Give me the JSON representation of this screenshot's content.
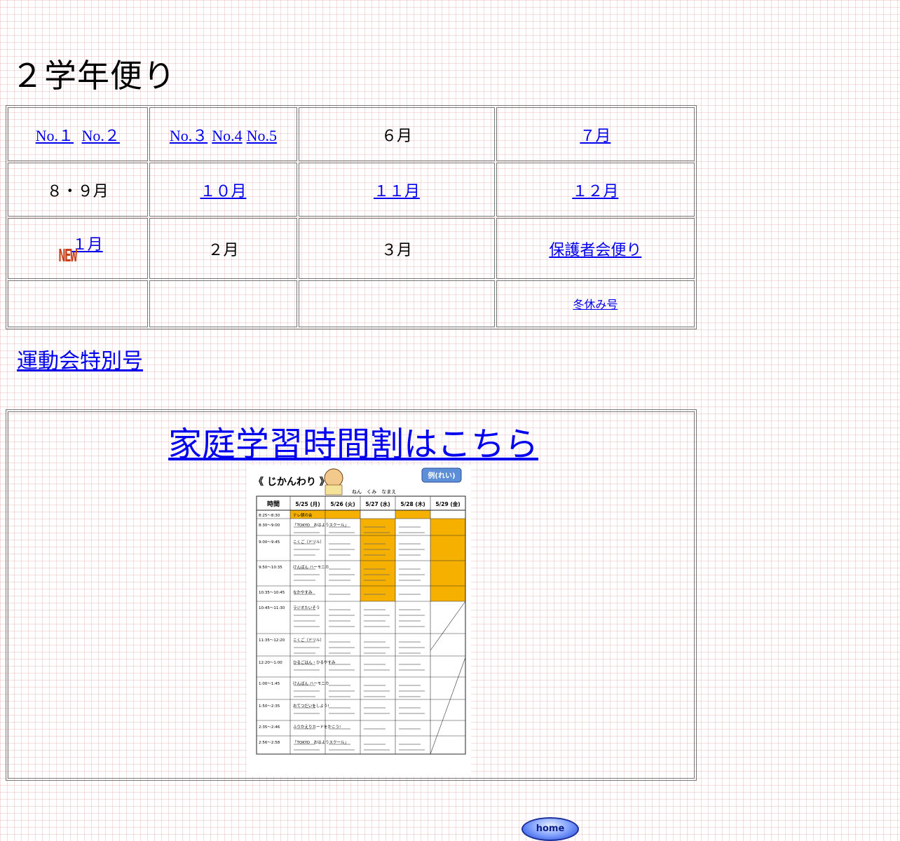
{
  "page": {
    "title": "２学年便り"
  },
  "issues": {
    "row1": {
      "no1": "No.１",
      "no2": "No.２",
      "no3": "No.３",
      "no4": "No.4",
      "no5": "No.5",
      "june": "６月",
      "july": "７月"
    },
    "row2": {
      "aug_sep": "８・９月",
      "oct": "１０月",
      "nov": "１１月",
      "dec": "１２月"
    },
    "row3": {
      "new_badge": "NEW",
      "jan": "１月",
      "feb": "２月",
      "mar": "３月",
      "parents": "保護者会便り"
    },
    "row4": {
      "winter": "冬休み号"
    }
  },
  "sports_day_link": "運動会特別号",
  "schedule": {
    "link": "家庭学習時間割はこちら",
    "thumbnail": {
      "heading": "《 じかんわり 》",
      "example_badge": "例(れい)",
      "name_line": "ねん　くみ　なまえ",
      "time_header": "時間",
      "days": [
        "5/25 (月)",
        "5/26 (火)",
        "5/27 (水)",
        "5/28 (木)",
        "5/29 (金)"
      ],
      "rows": [
        {
          "time": "8:25〜8:30",
          "text": "テレ朝の会"
        },
        {
          "time": "8:30〜9:00",
          "text": "「TOKYO　おはようスクール」"
        },
        {
          "time": "9:00〜9:45",
          "text": "こくご（ドリル）"
        },
        {
          "time": "9:50〜10:35",
          "text": "けんばん ハーモニカ"
        },
        {
          "time": "10:35〜10:45",
          "text": "なかやすみ"
        },
        {
          "time": "10:45〜11:30",
          "text": "ラジオたいそう"
        },
        {
          "time": "11:35〜12:20",
          "text": "こくご（ドリル）"
        },
        {
          "time": "12:20〜1:00",
          "text": "ひるごはん・ひるやすみ"
        },
        {
          "time": "1:00〜1:45",
          "text": "けんばん ハーモニカ"
        },
        {
          "time": "1:50〜2:35",
          "text": "おてつだいをしよう!"
        },
        {
          "time": "2:35〜2:46",
          "text": "ふりかえりカードをかこう!"
        },
        {
          "time": "2:56〜2:58",
          "text": "「TOKYO　おはようスクール」"
        }
      ]
    }
  },
  "home_button": "home",
  "colors": {
    "link": "#0000ee",
    "grid": "#e88c8c",
    "new_badge": "#c7401c",
    "highlight": "#f5b000"
  }
}
